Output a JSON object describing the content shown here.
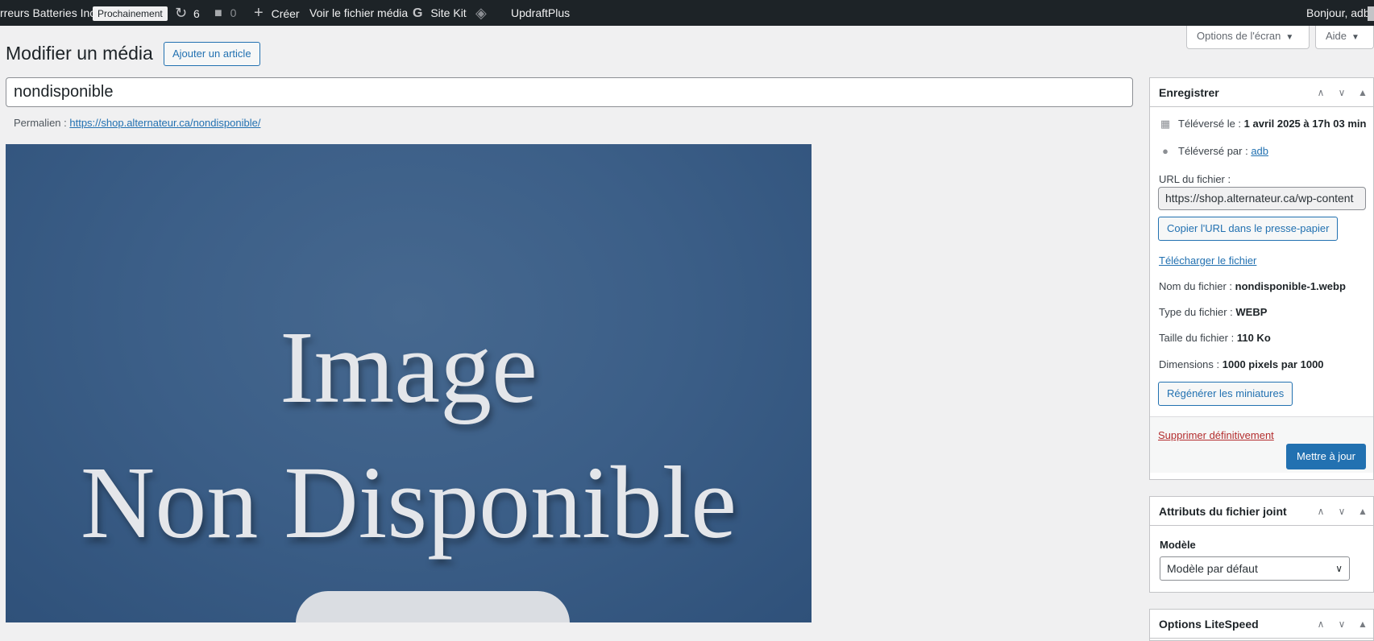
{
  "adminbar": {
    "site_name": "rreurs Batteries Inc",
    "badge": "Prochainement",
    "updates_count": "6",
    "comments_count": "0",
    "create_label": "Créer",
    "view_media_label": "Voir le fichier média",
    "sitekit_label": "Site Kit",
    "updraft_label": "UpdraftPlus",
    "greeting": "Bonjour, adb"
  },
  "screen_meta": {
    "options_label": "Options de l'écran",
    "help_label": "Aide"
  },
  "page": {
    "title": "Modifier un média",
    "add_button": "Ajouter un article",
    "media_title": "nondisponible",
    "permalink_label": "Permalien :",
    "permalink_url": "https://shop.alternateur.ca/nondisponible/"
  },
  "image": {
    "line1": "Image",
    "line2": "Non Disponible"
  },
  "save_box": {
    "title": "Enregistrer",
    "uploaded_on_label": "Téléversé le :",
    "uploaded_on_value": "1 avril 2025 à 17h 03 min",
    "uploaded_by_label": "Téléversé par :",
    "uploaded_by_value": "adb",
    "file_url_label": "URL du fichier :",
    "file_url_value": "https://shop.alternateur.ca/wp-content",
    "copy_url_button": "Copier l'URL dans le presse-papier",
    "download_link": "Télécharger le fichier",
    "filename_label": "Nom du fichier :",
    "filename_value": "nondisponible-1.webp",
    "filetype_label": "Type du fichier :",
    "filetype_value": "WEBP",
    "filesize_label": "Taille du fichier :",
    "filesize_value": "110 Ko",
    "dimensions_label": "Dimensions :",
    "dimensions_value": "1000 pixels par 1000",
    "regen_button": "Régénérer les miniatures",
    "delete_link": "Supprimer définitivement",
    "update_button": "Mettre à jour"
  },
  "attributes_box": {
    "title": "Attributs du fichier joint",
    "template_label": "Modèle",
    "template_value": "Modèle par défaut"
  },
  "litespeed_box": {
    "title": "Options LiteSpeed"
  }
}
